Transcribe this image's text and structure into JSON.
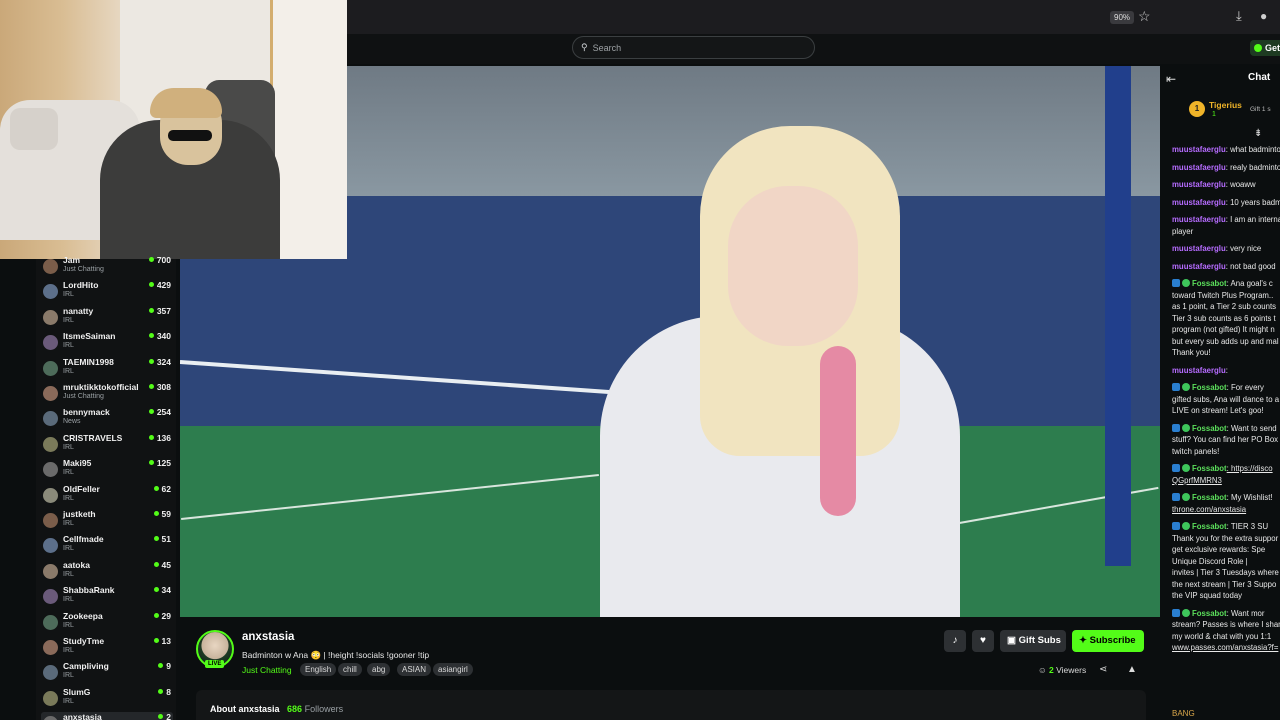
{
  "browser": {
    "zoom": "90%"
  },
  "header": {
    "search_placeholder": "Search",
    "get_label": "Get"
  },
  "sidebar": {
    "channels": [
      {
        "name": "Jam",
        "category": "Just Chatting",
        "count": "700"
      },
      {
        "name": "LordHito",
        "category": "IRL",
        "count": "429"
      },
      {
        "name": "nanatty",
        "category": "IRL",
        "count": "357"
      },
      {
        "name": "ItsmeSaiman",
        "category": "IRL",
        "count": "340"
      },
      {
        "name": "TAEMIN1998",
        "category": "IRL",
        "count": "324"
      },
      {
        "name": "mruktikktokofficial",
        "category": "Just Chatting",
        "count": "308"
      },
      {
        "name": "bennymack",
        "category": "News",
        "count": "254"
      },
      {
        "name": "CRISTRAVELS",
        "category": "IRL",
        "count": "136"
      },
      {
        "name": "Maki95",
        "category": "IRL",
        "count": "125"
      },
      {
        "name": "OldFeller",
        "category": "IRL",
        "count": "62"
      },
      {
        "name": "justketh",
        "category": "IRL",
        "count": "59"
      },
      {
        "name": "Cellfmade",
        "category": "IRL",
        "count": "51"
      },
      {
        "name": "aatoka",
        "category": "IRL",
        "count": "45"
      },
      {
        "name": "ShabbaRank",
        "category": "IRL",
        "count": "34"
      },
      {
        "name": "Zookeepa",
        "category": "IRL",
        "count": "29"
      },
      {
        "name": "StudyTme",
        "category": "IRL",
        "count": "13"
      },
      {
        "name": "Campliving",
        "category": "IRL",
        "count": "9"
      },
      {
        "name": "SlumG",
        "category": "IRL",
        "count": "8"
      },
      {
        "name": "anxstasia",
        "category": "",
        "count": "2"
      }
    ]
  },
  "chat": {
    "title": "Chat",
    "pinned": {
      "rank": "1",
      "name": "Tigerius",
      "sub": "1",
      "gift": "Gift 1 s"
    },
    "messages": [
      {
        "user": "muustafaerglu",
        "text": ": what badminto"
      },
      {
        "user": "muustafaerglu",
        "text": ": realy badminto"
      },
      {
        "user": "muustafaerglu",
        "text": ": woaww"
      },
      {
        "user": "muustafaerglu",
        "text": ": 10 years badm"
      },
      {
        "user": "muustafaerglu",
        "text": ": I am an interna"
      },
      {
        "user": "",
        "text": "player"
      },
      {
        "user": "muustafaerglu",
        "text": ": very nice"
      },
      {
        "user": "muustafaerglu",
        "text": ": not bad good"
      },
      {
        "user": "Fossabot",
        "text": ": Ana goal's c"
      },
      {
        "user": "",
        "text": "toward Twitch Plus Program.."
      },
      {
        "user": "",
        "text": "as 1 point, a Tier 2 sub counts"
      },
      {
        "user": "",
        "text": "Tier 3 sub counts as 6 points t"
      },
      {
        "user": "",
        "text": "program (not gifted) It might n"
      },
      {
        "user": "",
        "text": "but every sub adds up and mal"
      },
      {
        "user": "",
        "text": "Thank you!"
      },
      {
        "user": "muustafaerglu",
        "text": ":"
      },
      {
        "user": "Fossabot",
        "text": ": For every"
      },
      {
        "user": "",
        "text": "gifted subs, Ana will dance to a"
      },
      {
        "user": "",
        "text": "LIVE on stream! Let's goo!"
      },
      {
        "user": "Fossabot",
        "text": ": Want to send"
      },
      {
        "user": "",
        "text": "stuff? You can find her PO Box"
      },
      {
        "user": "",
        "text": "twitch panels!"
      },
      {
        "user": "Fossabot",
        "text": ": https://disco"
      },
      {
        "user": "",
        "text": "QGprfMMRN3"
      },
      {
        "user": "Fossabot",
        "text": ": My Wishlist!"
      },
      {
        "user": "",
        "text": "throne.com/anxstasia"
      },
      {
        "user": "Fossabot",
        "text": ": TIER 3 SU"
      },
      {
        "user": "",
        "text": "Thank you for the extra suppor"
      },
      {
        "user": "",
        "text": "get exclusive rewards: Spe"
      },
      {
        "user": "",
        "text": "Unique Discord Role |"
      },
      {
        "user": "",
        "text": "invites | Tier 3 Tuesdays where"
      },
      {
        "user": "",
        "text": "the next stream | Tier 3 Suppo"
      },
      {
        "user": "",
        "text": "the VIP squad today"
      },
      {
        "user": "Fossabot",
        "text": ": Want mor"
      },
      {
        "user": "",
        "text": "stream? Passes is where I shar"
      },
      {
        "user": "",
        "text": "my world & chat with you 1:1"
      },
      {
        "user": "",
        "text": "www.passes.com/anxstasia?f="
      }
    ],
    "emotes": "BANG"
  },
  "stream": {
    "username": "anxstasia",
    "live_label": "LIVE",
    "title": "Badminton w Ana 😳 | !height !socials !gooner !tip",
    "category": "Just Chatting",
    "tags": [
      "English",
      "chill",
      "abg",
      "ASIAN",
      "asiangirl"
    ],
    "gift_subs_label": "Gift Subs",
    "subscribe_label": "Subscribe",
    "viewers_count": "2",
    "viewers_label": "Viewers",
    "about_label": "About anxstasia",
    "followers_count": "686",
    "followers_label": "Followers"
  },
  "colors": {
    "accent": "#53fc18",
    "username_chat": "#b66cff",
    "bot": "#5ce05c"
  }
}
